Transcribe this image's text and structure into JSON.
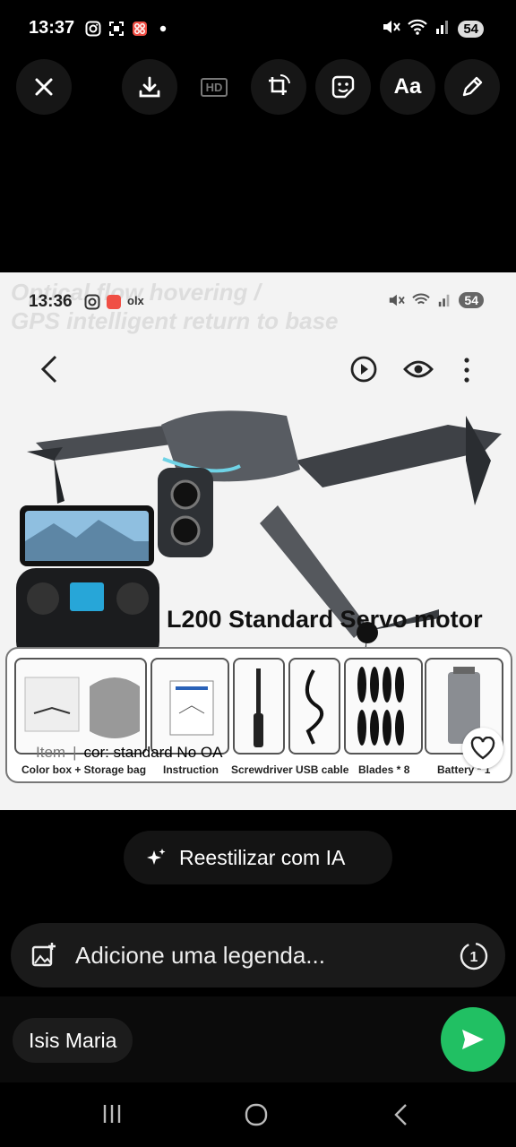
{
  "status_bar": {
    "time": "13:37",
    "battery": "54",
    "icons": [
      "instagram-icon",
      "screenshot-icon",
      "app-icon",
      "dot-icon",
      "mute-icon",
      "wifi-icon",
      "signal-icon"
    ]
  },
  "toolbar": {
    "buttons": [
      "close-icon",
      "download-icon",
      "hd-icon",
      "rotate-crop-icon",
      "sticker-icon",
      "text-icon",
      "pencil-icon"
    ],
    "hd_label": "HD",
    "text_label": "Aa"
  },
  "photo": {
    "inner_status": {
      "time": "13:36",
      "battery": "54",
      "olx": "olx"
    },
    "ghost_line1": "Optical flow hovering /",
    "ghost_line2": "GPS intelligent return to base",
    "title": "L200 Standard Servo motor",
    "accessories": [
      "Color box + Storage bag",
      "Instruction",
      "Screwdriver USB cable",
      "Blades * 8",
      "Battery * 1"
    ],
    "item_label": "Item",
    "item_value": "cor: standard No OA"
  },
  "restyle": {
    "label": "Reestilizar com IA"
  },
  "caption": {
    "placeholder": "Adicione uma legenda...",
    "timer": "1"
  },
  "recipient": {
    "name": "Isis Maria"
  }
}
